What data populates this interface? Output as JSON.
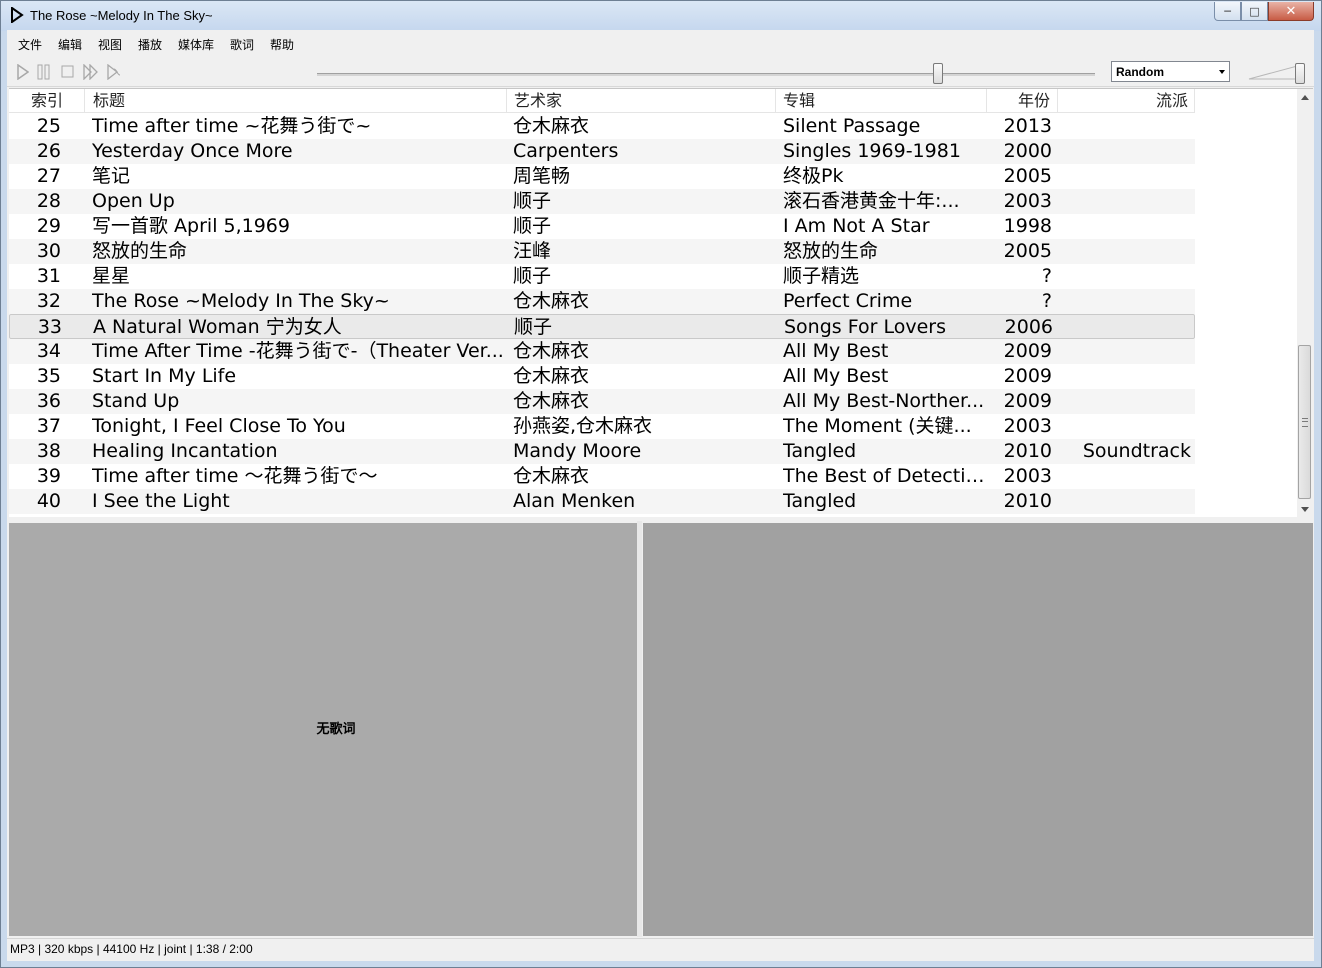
{
  "window": {
    "title": "The Rose ~Melody In The Sky~",
    "minimize": "─",
    "maximize": "□",
    "close": "✕"
  },
  "menu": [
    "文件",
    "编辑",
    "视图",
    "播放",
    "媒体库",
    "歌词",
    "帮助"
  ],
  "toolbar": {
    "icons": [
      "play-icon",
      "pause-icon",
      "stop-icon",
      "next-icon",
      "random-next-icon"
    ],
    "seek_position": 0.8,
    "playback_mode": "Random",
    "volume": 1.0
  },
  "playlist": {
    "columns": [
      "索引",
      "标题",
      "艺术家",
      "专辑",
      "年份",
      "流派"
    ],
    "selected_index": "33",
    "rows": [
      {
        "idx": "25",
        "title": "Time after time ~花舞う街で~",
        "artist": "仓木麻衣",
        "album": "Silent Passage",
        "year": "2013",
        "genre": ""
      },
      {
        "idx": "26",
        "title": "Yesterday Once More",
        "artist": "Carpenters",
        "album": "Singles 1969-1981",
        "year": "2000",
        "genre": ""
      },
      {
        "idx": "27",
        "title": "笔记",
        "artist": "周笔畅",
        "album": "终极Pk",
        "year": "2005",
        "genre": ""
      },
      {
        "idx": "28",
        "title": "Open Up",
        "artist": "顺子",
        "album": "滚石香港黄金十年:...",
        "year": "2003",
        "genre": ""
      },
      {
        "idx": "29",
        "title": "写一首歌 April 5,1969",
        "artist": "顺子",
        "album": "I Am Not A Star",
        "year": "1998",
        "genre": ""
      },
      {
        "idx": "30",
        "title": "怒放的生命",
        "artist": "汪峰",
        "album": "怒放的生命",
        "year": "2005",
        "genre": ""
      },
      {
        "idx": "31",
        "title": "星星",
        "artist": "顺子",
        "album": "顺子精选",
        "year": "?",
        "genre": ""
      },
      {
        "idx": "32",
        "title": "The Rose ~Melody In The Sky~",
        "artist": "仓木麻衣",
        "album": "Perfect Crime",
        "year": "?",
        "genre": ""
      },
      {
        "idx": "33",
        "title": "A Natural Woman 宁为女人",
        "artist": "顺子",
        "album": "Songs For Lovers",
        "year": "2006",
        "genre": ""
      },
      {
        "idx": "34",
        "title": "Time After Time -花舞う街で-（Theater Ver...",
        "artist": "仓木麻衣",
        "album": "All My Best",
        "year": "2009",
        "genre": ""
      },
      {
        "idx": "35",
        "title": "Start In My Life",
        "artist": "仓木麻衣",
        "album": "All My Best",
        "year": "2009",
        "genre": ""
      },
      {
        "idx": "36",
        "title": "Stand Up",
        "artist": "仓木麻衣",
        "album": "All My Best-Norther...",
        "year": "2009",
        "genre": ""
      },
      {
        "idx": "37",
        "title": "Tonight, I Feel Close To You",
        "artist": "孙燕姿,仓木麻衣",
        "album": "The Moment (关键...",
        "year": "2003",
        "genre": ""
      },
      {
        "idx": "38",
        "title": "Healing Incantation",
        "artist": "Mandy Moore",
        "album": "Tangled",
        "year": "2010",
        "genre": "Soundtrack"
      },
      {
        "idx": "39",
        "title": "Time after time ～花舞う街で～",
        "artist": "仓木麻衣",
        "album": "The Best of Detectiv...",
        "year": "2003",
        "genre": ""
      },
      {
        "idx": "40",
        "title": "I See the Light",
        "artist": "Alan Menken",
        "album": "Tangled",
        "year": "2010",
        "genre": ""
      }
    ]
  },
  "lyrics": {
    "empty_text": "无歌词"
  },
  "status": {
    "text": "MP3 | 320 kbps | 44100 Hz | joint | 1:38 / 2:00"
  },
  "colors": {
    "title_bar": "#c9d9ec",
    "lyrics_bg": "#aaaaaa",
    "visual_bg": "#a1a1a1",
    "row_alt": "#f5f5f5"
  }
}
